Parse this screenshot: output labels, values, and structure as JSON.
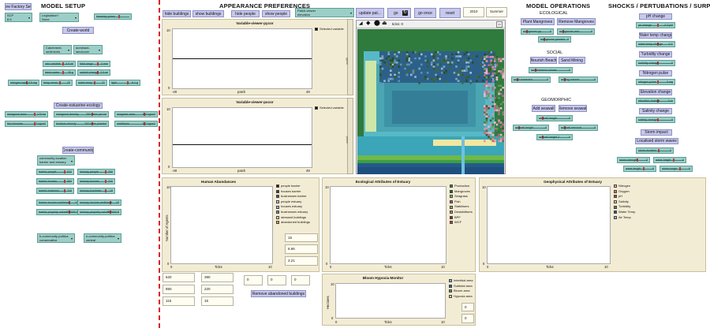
{
  "headings": {
    "model_setup": "MODEL SETUP",
    "appearance": "APPEARANCE PREFERENCES",
    "model_operations": "MODEL OPERATIONS",
    "shocks": "SHOCKS / PERTUBATIONS / SURPRISES"
  },
  "setup": {
    "restore_btn": "Restore Factory Settings",
    "scp": {
      "label": "SCP",
      "value": "8.5"
    },
    "legislation": {
      "label": "Legislation?",
      "value": "None"
    },
    "top_slider": {
      "label": "timestep-years",
      "value": "0"
    },
    "create_world": "Create-world",
    "catchment": {
      "label": "Catchment-sediments",
      "value": "medium"
    },
    "landcover": {
      "label": "dominant-landcover",
      "value": "innoculated"
    },
    "sliders_world": [
      {
        "label": "rain-variable",
        "value": "4.5 ml"
      },
      {
        "label": "tidal-range",
        "value": "4 mm"
      },
      {
        "label": "fresh-water",
        "value": "35 g"
      },
      {
        "label": "rainfall-change",
        "value": "2.5 ml"
      },
      {
        "label": "nitrogen-input",
        "value": "0.5 mg"
      },
      {
        "label": "temp-mean",
        "value": "20"
      },
      {
        "label": "water-temp",
        "value": "21"
      },
      {
        "label": "light",
        "value": "8.1 g"
      }
    ],
    "create_ecology": "Create-estuarine-ecology",
    "sliders_ecology": [
      {
        "label": "mangrove-area",
        "value": "170 ha"
      },
      {
        "label": "mangrove-density",
        "value": "250 trees per ha"
      },
      {
        "label": "seagrass-area",
        "value": "120 kg/m2"
      },
      {
        "label": "fish-biomass",
        "value": "2 kg/m2"
      },
      {
        "label": "bivalves-density",
        "value": "250 trees planted"
      },
      {
        "label": "stabilisers",
        "value": "120 kg/m2"
      }
    ],
    "create_community": "Create-community",
    "community_location": {
      "label": "community-location",
      "value": "barrier and estuary"
    },
    "sliders_community": [
      {
        "label": "barrier-people",
        "value": "620"
      },
      {
        "label": "estuary-people",
        "value": "390"
      },
      {
        "label": "barrier-houses",
        "value": "850"
      },
      {
        "label": "estuary-houses",
        "value": "220"
      },
      {
        "label": "barrier-business",
        "value": "115"
      },
      {
        "label": "estuary-business",
        "value": "15"
      },
      {
        "label": "barrier-income-resilience",
        "value": "15"
      },
      {
        "label": "estuary-income-resilience",
        "value": "15"
      },
      {
        "label": "barrier-property-values",
        "value": "250000 $"
      },
      {
        "label": "estuary-property-values",
        "value": "300000 $"
      }
    ],
    "politics_b": {
      "label": "b-community-politics",
      "value": "conservative"
    },
    "politics_e": {
      "label": "e-community-politics",
      "value": "central"
    }
  },
  "appearance": {
    "hide_buildings": "hide buildings",
    "show_buildings": "show buildings",
    "hide_people": "hide people",
    "show_people": "show people",
    "patch_viewer": {
      "label": "Patch-viewer",
      "value": "elevation"
    }
  },
  "viewer_plots": [
    {
      "title": "Variable-viewer-pycor",
      "legend": "Selected variable",
      "ymax": "10",
      "ymin": "0",
      "xmin": "-49",
      "xmax": "49",
      "xlabel": "patch",
      "side": "pycor"
    },
    {
      "title": "Variable-viewer-pxcor",
      "legend": "Selected variable",
      "ymax": "10",
      "ymin": "0",
      "xmin": "-49",
      "xmax": "49",
      "xlabel": "patch",
      "side": "pxcor"
    }
  ],
  "controls": {
    "update": "update pat...",
    "go": "go",
    "go_once": "go once",
    "reset": "reset",
    "year": "2010",
    "season": "Summer",
    "ticks": "ticks: 0"
  },
  "operations": {
    "ecological": "ECOLOGICAL",
    "plant_mangroves": "Plant Mangroves",
    "remove_mangroves": "Remove Mangroves",
    "eco_sliders": [
      {
        "label": "mangroves-pp...",
        "value": "0"
      },
      {
        "label": "mangroves-rem...",
        "value": "0"
      },
      {
        "label": "mangroves-planted",
        "value": "0"
      }
    ],
    "social": "SOCIAL",
    "nourish_beach": "Nourish Beach",
    "sand_mining": "Sand Mining",
    "social_sliders": [
      {
        "label": "nourishment-volume",
        "value": "0"
      },
      {
        "label": "sand-extracted",
        "value": "0"
      },
      {
        "label": "mining-volume",
        "value": "0"
      }
    ],
    "geomorphic": "GEOMORPHIC",
    "add_seawall": "Add seawall",
    "remove_seawall": "Remove seawall",
    "geo_sliders": [
      {
        "label": "seawall-length",
        "value": "0"
      },
      {
        "label": "seawall-height",
        "value": "0"
      },
      {
        "label": "seawall-removal",
        "value": "0"
      },
      {
        "label": "seawall-height-2",
        "value": "0"
      }
    ]
  },
  "shocks": {
    "items": [
      {
        "button": "pH change",
        "slider": {
          "label": "ph-change",
          "value": "-0.3 pH"
        }
      },
      {
        "button": "Water temp change",
        "slider": {
          "label": "water-temp-change",
          "value": "2 C"
        }
      },
      {
        "button": "Turbidity change",
        "slider": {
          "label": "turbidity-change",
          "value": "0"
        }
      },
      {
        "button": "Nitrogen pulse",
        "slider": {
          "label": "nitrogen-pulse",
          "value": "0 mg"
        }
      },
      {
        "button": "Elevation change",
        "slider": {
          "label": "elevation-change",
          "value": "0 m"
        }
      },
      {
        "button": "Salinity change",
        "slider": {
          "label": "salinity-change",
          "value": "0"
        }
      }
    ],
    "storm_impact": "Storm impact",
    "localised_waves": "Localised storm waves",
    "storm_sliders": [
      {
        "label": "storm-duration",
        "value": "0"
      },
      {
        "label": "storm-strength",
        "value": "0"
      },
      {
        "label": "wave-height",
        "value": "0"
      },
      {
        "label": "wave-length",
        "value": "0"
      },
      {
        "label": "storm-surge",
        "value": "0"
      }
    ]
  },
  "human_plot": {
    "title": "Human Abundances",
    "ylabel": "Number of Agents",
    "xlabel": "Ticks",
    "ymax": "10",
    "ymin": "0",
    "xmin": "0",
    "xmax": "10",
    "legend": [
      {
        "label": "people barrier",
        "color": "#222222"
      },
      {
        "label": "houses barrier",
        "color": "#333a5c"
      },
      {
        "label": "businesses barrier",
        "color": "#4a4d78"
      },
      {
        "label": "people estuary",
        "color": "#c7c8ec"
      },
      {
        "label": "houses estuary",
        "color": "#a8abd8"
      },
      {
        "label": "businesses estuary",
        "color": "#7c80c0"
      },
      {
        "label": "stressed buildings",
        "color": "#f0dd7a"
      },
      {
        "label": "abandoned buildings",
        "color": "#f49a3c"
      }
    ],
    "monitors": [
      "15",
      "6.66",
      "3.21"
    ]
  },
  "eco_plot": {
    "title": "Ecological Attributes of Estuary",
    "xlabel": "Ticks",
    "ymax": "10",
    "ymin": "0",
    "xmin": "0",
    "xmax": "10",
    "legend": [
      {
        "label": "Production",
        "color": "#2e8b3a"
      },
      {
        "label": "Mangroves",
        "color": "#1f5e2c"
      },
      {
        "label": "Seagrass",
        "color": "#6bbf5a"
      },
      {
        "label": "Fish",
        "color": "#d13a8a"
      },
      {
        "label": "Stabilisers",
        "color": "#88b04b"
      },
      {
        "label": "Destabilisers",
        "color": "#b98c50"
      },
      {
        "label": "BPF",
        "color": "#7a2f2f"
      },
      {
        "label": "WCF",
        "color": "#d8342c"
      }
    ]
  },
  "geo_plot": {
    "title": "Geophysical Attributes of Estuary",
    "xlabel": "Ticks",
    "ymax": "10",
    "ymin": "0",
    "xmin": "0",
    "xmax": "10",
    "legend": [
      {
        "label": "Nitrogen",
        "color": "#f2a0a0"
      },
      {
        "label": "Oxygen",
        "color": "#e07a3e"
      },
      {
        "label": "pH",
        "color": "#c23a3a"
      },
      {
        "label": "Salinity",
        "color": "#e2cc6a"
      },
      {
        "label": "Turbidity",
        "color": "#8e6b3a"
      },
      {
        "label": "Water Temp",
        "color": "#2d4a9a"
      },
      {
        "label": "Air Temp",
        "color": "#9aa5e0"
      }
    ]
  },
  "bloom_plot": {
    "title": "Bloom Hypoxia Monitor",
    "ylabel": "Hectares",
    "xlabel": "Ticks",
    "ymax": "10",
    "ymin": "0",
    "xmin": "0",
    "xmax": "10",
    "legend": [
      {
        "label": "Intertidal area",
        "color": "#6fb4e0"
      },
      {
        "label": "Subtidal area",
        "color": "#2f5ea8"
      },
      {
        "label": "Bloom area",
        "color": "#3e9a4a"
      },
      {
        "label": "Hypoxia area",
        "color": "#e0c8a0"
      }
    ],
    "monitors": [
      "0",
      "0"
    ]
  },
  "bottom_monitors": {
    "pairs": [
      [
        "620",
        "390"
      ],
      [
        "850",
        "220"
      ],
      [
        "115",
        "15"
      ]
    ],
    "zeros": [
      "0",
      "0",
      "0"
    ],
    "remove_abandoned": "Remove abandoned buildings"
  }
}
